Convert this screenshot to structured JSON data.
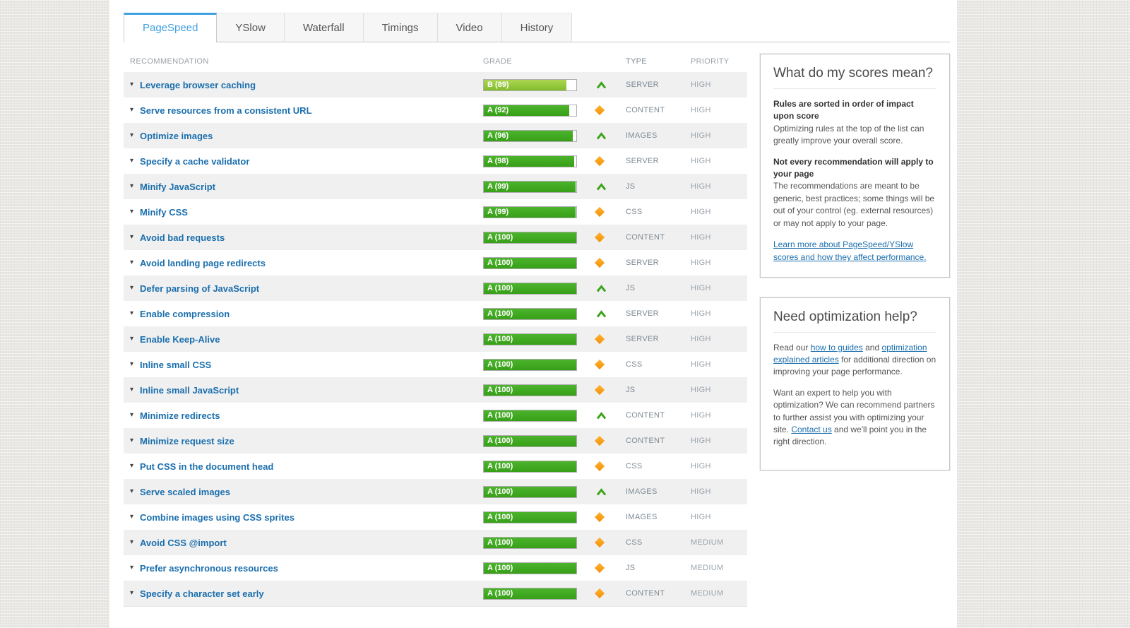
{
  "tabs": [
    {
      "label": "PageSpeed",
      "active": true
    },
    {
      "label": "YSlow",
      "active": false
    },
    {
      "label": "Waterfall",
      "active": false
    },
    {
      "label": "Timings",
      "active": false
    },
    {
      "label": "Video",
      "active": false
    },
    {
      "label": "History",
      "active": false
    }
  ],
  "table": {
    "headers": [
      "RECOMMENDATION",
      "GRADE",
      "TYPE",
      "PRIORITY"
    ],
    "rows": [
      {
        "name": "Leverage browser caching",
        "grade_label": "B (89)",
        "score": 89,
        "letter": "B",
        "trend_icon": "chevron-up",
        "type": "SERVER",
        "priority": "HIGH"
      },
      {
        "name": "Serve resources from a consistent URL",
        "grade_label": "A (92)",
        "score": 92,
        "letter": "A",
        "trend_icon": "diamond",
        "type": "CONTENT",
        "priority": "HIGH"
      },
      {
        "name": "Optimize images",
        "grade_label": "A (96)",
        "score": 96,
        "letter": "A",
        "trend_icon": "chevron-up",
        "type": "IMAGES",
        "priority": "HIGH"
      },
      {
        "name": "Specify a cache validator",
        "grade_label": "A (98)",
        "score": 98,
        "letter": "A",
        "trend_icon": "diamond",
        "type": "SERVER",
        "priority": "HIGH"
      },
      {
        "name": "Minify JavaScript",
        "grade_label": "A (99)",
        "score": 99,
        "letter": "A",
        "trend_icon": "chevron-up",
        "type": "JS",
        "priority": "HIGH"
      },
      {
        "name": "Minify CSS",
        "grade_label": "A (99)",
        "score": 99,
        "letter": "A",
        "trend_icon": "diamond",
        "type": "CSS",
        "priority": "HIGH"
      },
      {
        "name": "Avoid bad requests",
        "grade_label": "A (100)",
        "score": 100,
        "letter": "A",
        "trend_icon": "diamond",
        "type": "CONTENT",
        "priority": "HIGH"
      },
      {
        "name": "Avoid landing page redirects",
        "grade_label": "A (100)",
        "score": 100,
        "letter": "A",
        "trend_icon": "diamond",
        "type": "SERVER",
        "priority": "HIGH"
      },
      {
        "name": "Defer parsing of JavaScript",
        "grade_label": "A (100)",
        "score": 100,
        "letter": "A",
        "trend_icon": "chevron-up",
        "type": "JS",
        "priority": "HIGH"
      },
      {
        "name": "Enable compression",
        "grade_label": "A (100)",
        "score": 100,
        "letter": "A",
        "trend_icon": "chevron-up",
        "type": "SERVER",
        "priority": "HIGH"
      },
      {
        "name": "Enable Keep-Alive",
        "grade_label": "A (100)",
        "score": 100,
        "letter": "A",
        "trend_icon": "diamond",
        "type": "SERVER",
        "priority": "HIGH"
      },
      {
        "name": "Inline small CSS",
        "grade_label": "A (100)",
        "score": 100,
        "letter": "A",
        "trend_icon": "diamond",
        "type": "CSS",
        "priority": "HIGH"
      },
      {
        "name": "Inline small JavaScript",
        "grade_label": "A (100)",
        "score": 100,
        "letter": "A",
        "trend_icon": "diamond",
        "type": "JS",
        "priority": "HIGH"
      },
      {
        "name": "Minimize redirects",
        "grade_label": "A (100)",
        "score": 100,
        "letter": "A",
        "trend_icon": "chevron-up",
        "type": "CONTENT",
        "priority": "HIGH"
      },
      {
        "name": "Minimize request size",
        "grade_label": "A (100)",
        "score": 100,
        "letter": "A",
        "trend_icon": "diamond",
        "type": "CONTENT",
        "priority": "HIGH"
      },
      {
        "name": "Put CSS in the document head",
        "grade_label": "A (100)",
        "score": 100,
        "letter": "A",
        "trend_icon": "diamond",
        "type": "CSS",
        "priority": "HIGH"
      },
      {
        "name": "Serve scaled images",
        "grade_label": "A (100)",
        "score": 100,
        "letter": "A",
        "trend_icon": "chevron-up",
        "type": "IMAGES",
        "priority": "HIGH"
      },
      {
        "name": "Combine images using CSS sprites",
        "grade_label": "A (100)",
        "score": 100,
        "letter": "A",
        "trend_icon": "diamond",
        "type": "IMAGES",
        "priority": "HIGH"
      },
      {
        "name": "Avoid CSS @import",
        "grade_label": "A (100)",
        "score": 100,
        "letter": "A",
        "trend_icon": "diamond",
        "type": "CSS",
        "priority": "MEDIUM"
      },
      {
        "name": "Prefer asynchronous resources",
        "grade_label": "A (100)",
        "score": 100,
        "letter": "A",
        "trend_icon": "diamond",
        "type": "JS",
        "priority": "MEDIUM"
      },
      {
        "name": "Specify a character set early",
        "grade_label": "A (100)",
        "score": 100,
        "letter": "A",
        "trend_icon": "diamond",
        "type": "CONTENT",
        "priority": "MEDIUM"
      }
    ]
  },
  "sidebar": {
    "scores_box": {
      "title": "What do my scores mean?",
      "sections": [
        {
          "heading": "Rules are sorted in order of impact upon score",
          "text": "Optimizing rules at the top of the list can greatly improve your overall score."
        },
        {
          "heading": "Not every recommendation will apply to your page",
          "text": "The recommendations are meant to be generic, best practices; some things will be out of your control (eg. external resources) or may not apply to your page."
        }
      ],
      "link": "Learn more about PageSpeed/YSlow scores and how they affect performance."
    },
    "help_box": {
      "title": "Need optimization help?",
      "para1_segments": [
        {
          "t": "Read our "
        },
        {
          "t": "how to guides",
          "link": true
        },
        {
          "t": " and "
        },
        {
          "t": "optimization explained articles",
          "link": true
        },
        {
          "t": " for additional direction on improving your page performance."
        }
      ],
      "para2_segments": [
        {
          "t": "Want an expert to help you with optimization? We can recommend partners to further assist you with optimizing your site. "
        },
        {
          "t": "Contact us",
          "link": true
        },
        {
          "t": " and we'll point you in the right direction."
        }
      ]
    }
  },
  "colors": {
    "grade_a": "#38a018",
    "grade_b": "#82bd2c",
    "chevron_green": "#3aa317",
    "diamond_orange": "#f29105",
    "tab_active_blue": "#41a2e0",
    "link_blue": "#1b6fae"
  }
}
